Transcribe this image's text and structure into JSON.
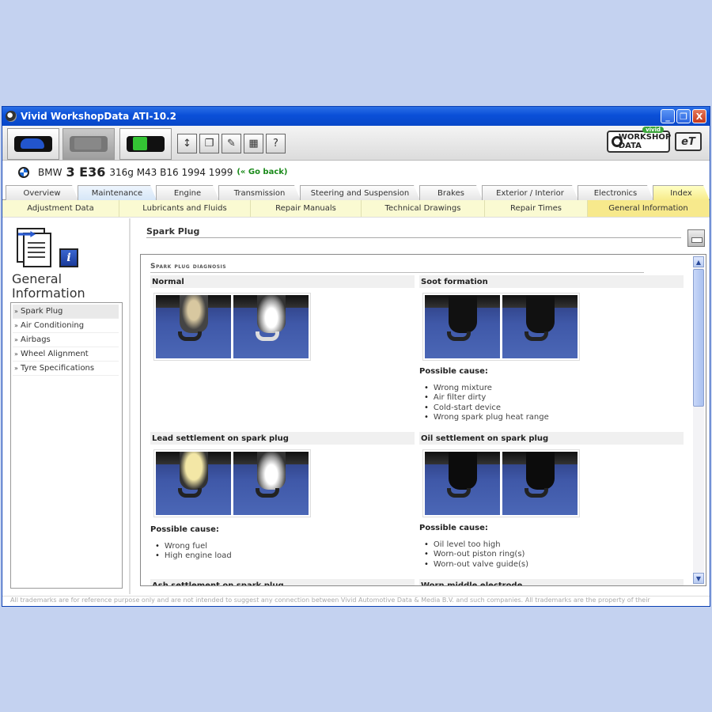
{
  "window": {
    "title": "Vivid WorkshopData ATI-10.2",
    "buttons": [
      "_",
      "❐",
      "X"
    ]
  },
  "toolbar": {
    "tool_icons": [
      "adjust-icon",
      "copy-icon",
      "edit-icon",
      "calculator-icon",
      "help-icon"
    ],
    "tool_glyphs": [
      "↕",
      "❐",
      "✎",
      "▦",
      "?"
    ],
    "brand_logo": "WORKSHOP DATA",
    "brand_vivid": "vivid",
    "et_logo": "eT"
  },
  "vehicle": {
    "make": "BMW",
    "model": "3 E36",
    "spec": "316g M43 B16 1994 1999",
    "back_link": "(« Go back)"
  },
  "tabs": [
    "Overview",
    "Maintenance",
    "Engine",
    "Transmission",
    "Steering and Suspension",
    "Brakes",
    "Exterior / Interior",
    "Electronics",
    "Index"
  ],
  "subtabs": [
    "Adjustment Data",
    "Lubricants and Fluids",
    "Repair Manuals",
    "Technical Drawings",
    "Repair Times",
    "General Information"
  ],
  "sidebar": {
    "title_line1": "General",
    "title_line2": "Information",
    "items": [
      "Spark Plug",
      "Air Conditioning",
      "Airbags",
      "Wheel Alignment",
      "Tyre Specifications"
    ]
  },
  "content": {
    "header": "Spark Plug",
    "diagnosis_title": "Spark plug diagnosis",
    "blocks": [
      {
        "title": "Normal"
      },
      {
        "title": "Soot formation",
        "cause_label": "Possible cause:",
        "causes": [
          "Wrong mixture",
          "Air filter dirty",
          "Cold-start device",
          "Wrong spark plug heat range"
        ]
      },
      {
        "title": "Lead settlement on spark plug",
        "cause_label": "Possible cause:",
        "causes": [
          "Wrong fuel",
          "High engine load"
        ]
      },
      {
        "title": "Oil settlement on spark plug",
        "cause_label": "Possible cause:",
        "causes": [
          "Oil level too high",
          "Worn-out piston ring(s)",
          "Worn-out valve guide(s)"
        ]
      },
      {
        "title": "Ash settlement on spark plug"
      },
      {
        "title": "Worn middle electrode"
      }
    ]
  },
  "footer": "All trademarks are for reference purpose only and are not intended to suggest any connection between Vivid Automotive Data & Media B.V. and such companies. All trademarks are the property of their"
}
